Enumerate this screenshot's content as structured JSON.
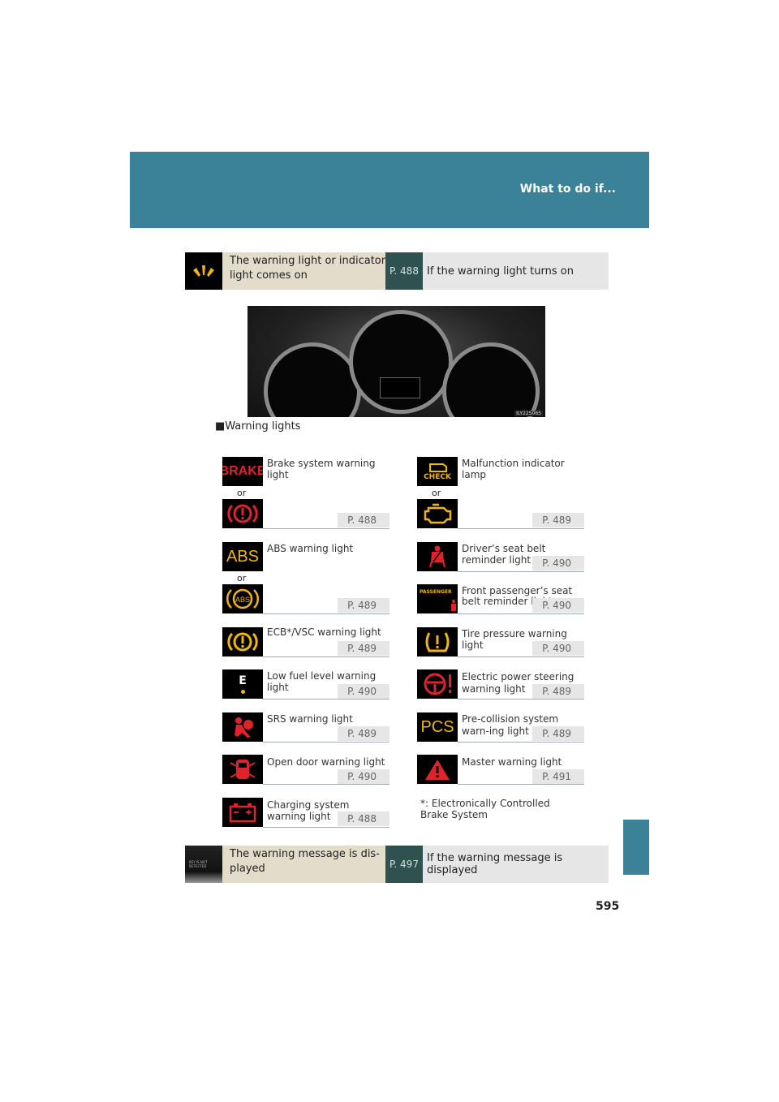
{
  "header": {
    "title": "What to do if..."
  },
  "banner_top": {
    "icon": "warning-light-flash-icon",
    "label": "The warning light or indicator light comes on",
    "page": "P. 488",
    "text": "If the warning light turns on"
  },
  "cluster": {
    "code": "ILY22S065"
  },
  "section_heading": "■Warning lights",
  "or_label": "or",
  "left_items": [
    {
      "label": "Brake system warning light",
      "page": "P. 488",
      "icons": [
        "BRAKE",
        "brake-circle-icon"
      ]
    },
    {
      "label": "ABS warning light",
      "page": "P. 489",
      "icons": [
        "ABS",
        "ABS"
      ]
    },
    {
      "label": "ECB*/VSC warning light",
      "page": "P. 489",
      "icons": [
        "ecb-vsc-icon"
      ]
    },
    {
      "label": "Low fuel level warning light",
      "page": "P. 490",
      "icons": [
        "E"
      ]
    },
    {
      "label": "SRS warning light",
      "page": "P. 489",
      "icons": [
        "srs-airbag-icon"
      ]
    },
    {
      "label": "Open door warning light",
      "page": "P. 490",
      "icons": [
        "open-door-icon"
      ]
    },
    {
      "label": "Charging system warning light",
      "page": "P. 488",
      "icons": [
        "battery-icon"
      ]
    }
  ],
  "right_items": [
    {
      "label": "Malfunction indicator lamp",
      "page": "P. 489",
      "icons": [
        "CHECK",
        "engine-icon"
      ]
    },
    {
      "label": "Driver’s seat belt reminder light",
      "page": "P. 490",
      "icons": [
        "seat-belt-icon"
      ]
    },
    {
      "label": "Front passenger’s seat belt reminder light",
      "page": "P. 490",
      "icons": [
        "PASSENGER"
      ]
    },
    {
      "label": "Tire pressure warning light",
      "page": "P. 490",
      "icons": [
        "tire-pressure-icon"
      ]
    },
    {
      "label": "Electric power steering warning light",
      "page": "P. 489",
      "icons": [
        "steering-icon"
      ]
    },
    {
      "label": "Pre-collision system warn-ing light",
      "page": "P. 489",
      "icons": [
        "PCS"
      ]
    },
    {
      "label": "Master warning light",
      "page": "P. 491",
      "icons": [
        "master-warning-icon"
      ]
    }
  ],
  "footnote": "*: Electronically Controlled Brake System",
  "banner_bottom": {
    "icon": "message-display-icon",
    "icon_text": "KEY IS NOT DETECTED",
    "label": "The warning message is dis-played",
    "page": "P. 497",
    "text": "If the warning message is displayed"
  },
  "page_number": "595",
  "colors": {
    "header": "#3b8299",
    "red": "#e0222a",
    "amber": "#f2b705",
    "banner_beige": "#e3dccb",
    "page_box": "#2f5250"
  }
}
